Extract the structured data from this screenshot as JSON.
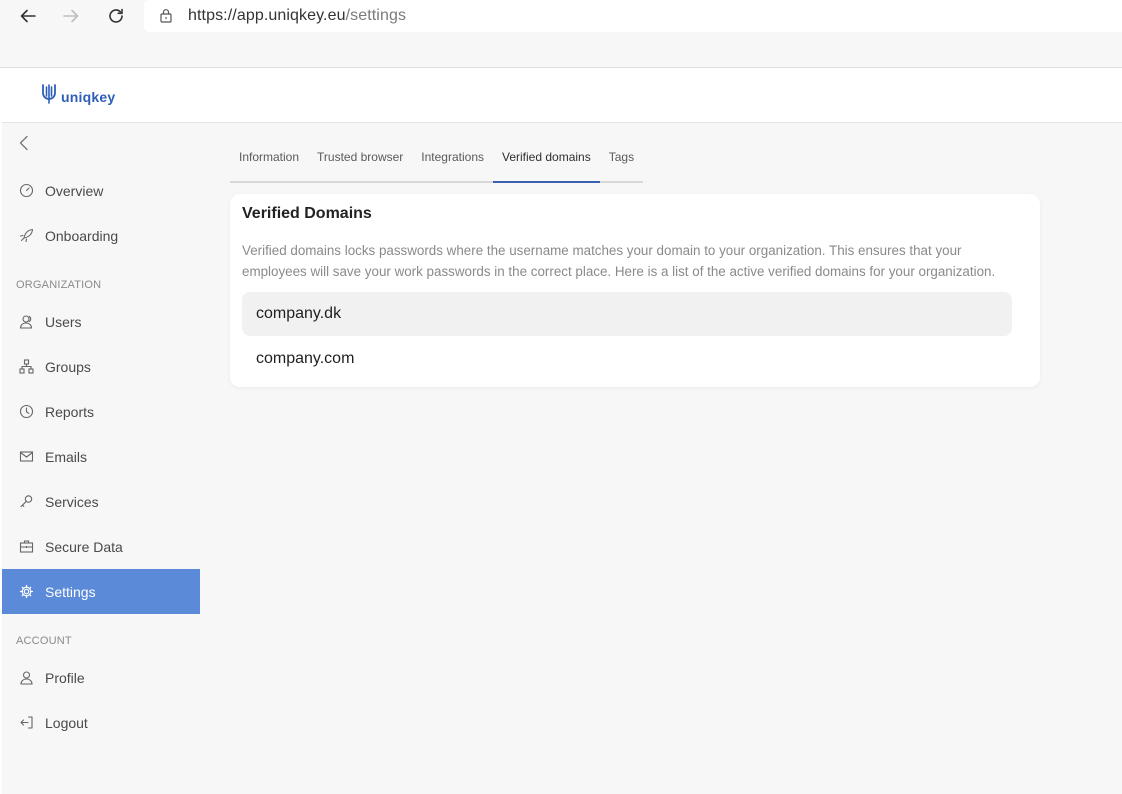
{
  "browser": {
    "url_host": "https://app.uniqkey.eu",
    "url_path": "/settings",
    "icons": [
      "back-arrow-icon",
      "forward-arrow-icon",
      "reload-icon",
      "lock-icon"
    ]
  },
  "app": {
    "logo_text": "uniqkey",
    "brand_color": "#2d5fb8",
    "accent_color": "#5b8ad8"
  },
  "sidebar": {
    "items_top": [
      {
        "label": "Overview",
        "icon": "gauge-icon"
      },
      {
        "label": "Onboarding",
        "icon": "rocket-icon"
      }
    ],
    "org_title": "ORGANIZATION",
    "items_org": [
      {
        "label": "Users",
        "icon": "user-group-icon"
      },
      {
        "label": "Groups",
        "icon": "hierarchy-icon"
      },
      {
        "label": "Reports",
        "icon": "clock-icon"
      },
      {
        "label": "Emails",
        "icon": "mail-icon"
      },
      {
        "label": "Services",
        "icon": "key-icon"
      },
      {
        "label": "Secure Data",
        "icon": "briefcase-icon"
      },
      {
        "label": "Settings",
        "icon": "gear-icon",
        "active": true
      }
    ],
    "account_title": "ACCOUNT",
    "items_account": [
      {
        "label": "Profile",
        "icon": "user-icon"
      },
      {
        "label": "Logout",
        "icon": "logout-icon"
      }
    ]
  },
  "tabs": [
    {
      "label": "Information"
    },
    {
      "label": "Trusted browser"
    },
    {
      "label": "Integrations"
    },
    {
      "label": "Verified domains",
      "active": true
    },
    {
      "label": "Tags"
    }
  ],
  "card": {
    "title": "Verified Domains",
    "description_line1": "Verified domains locks passwords where the username matches your domain to your organization. This ensures that your",
    "description_line2": "employees will save your work passwords in the correct place. Here is a list of the active verified domains for your organization.",
    "domains": [
      "company.dk",
      "company.com"
    ]
  }
}
